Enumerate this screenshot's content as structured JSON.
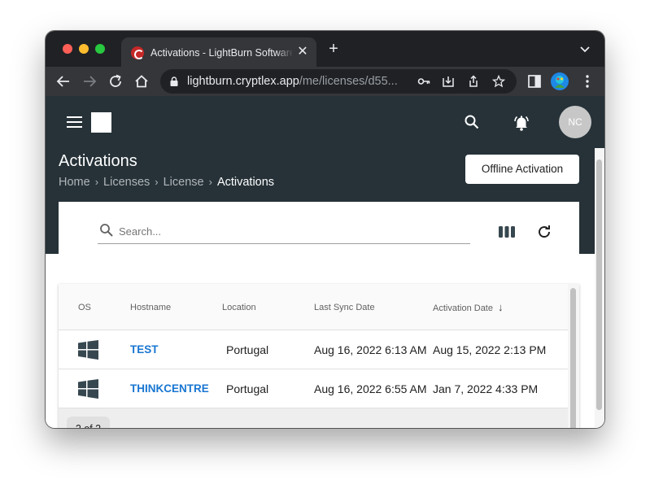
{
  "browser": {
    "tab_title": "Activations - LightBurn Software",
    "tab_close": "✕",
    "new_tab": "+",
    "url_host": "lightburn.cryptlex.app",
    "url_path": "/me/licenses/d55..."
  },
  "header": {
    "avatar_initials": "NC"
  },
  "page": {
    "title": "Activations",
    "breadcrumb": [
      "Home",
      "Licenses",
      "License",
      "Activations"
    ],
    "breadcrumb_sep": "›",
    "offline_button": "Offline Activation"
  },
  "toolbar": {
    "search_placeholder": "Search..."
  },
  "table": {
    "columns": [
      "OS",
      "Hostname",
      "Location",
      "Last Sync Date",
      "Activation Date"
    ],
    "sort_arrow": "↓",
    "rows": [
      {
        "os": "windows-icon",
        "hostname": "TEST",
        "location": "Portugal",
        "last_sync": "Aug 16, 2022 6:13 AM",
        "activation_date": "Aug 15, 2022 2:13 PM"
      },
      {
        "os": "windows-icon",
        "hostname": "THINKCENTRE",
        "location": "Portugal",
        "last_sync": "Aug 16, 2022 6:55 AM",
        "activation_date": "Jan 7, 2022 4:33 PM"
      }
    ],
    "count": "2 of 2"
  },
  "colors": {
    "header_bg": "#263238",
    "link": "#1976d2",
    "browser_dark": "#202124",
    "browser_tab": "#35363a"
  }
}
